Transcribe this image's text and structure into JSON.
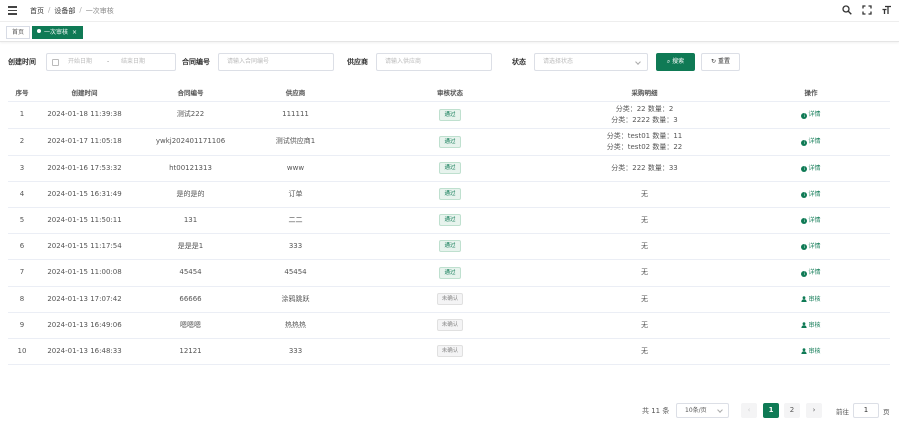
{
  "breadcrumb": [
    "首页",
    "设备部",
    "一次审核"
  ],
  "tags": {
    "home": "首页",
    "active": "一次审核",
    "close": "×"
  },
  "filters": {
    "created_label": "创建时间",
    "start_placeholder": "开始日期",
    "range_sep": "-",
    "end_placeholder": "结束日期",
    "contract_label": "合同编号",
    "contract_placeholder": "请输入合同编号",
    "supplier_label": "供应商",
    "supplier_placeholder": "请输入供应商",
    "status_label": "状态",
    "status_placeholder": "请选择状态",
    "search_button": "搜索",
    "reset_button": "重置"
  },
  "table": {
    "columns": [
      "序号",
      "创建时间",
      "合同编号",
      "供应商",
      "审核状态",
      "采购明细",
      "操作"
    ],
    "rows": [
      {
        "no": "1",
        "time": "2024-01-18 11:39:38",
        "contract": "测试222",
        "supplier": "111111",
        "status": "通过",
        "status_type": "pass",
        "details": [
          "分类：22 数量：2",
          "分类：2222 数量：3"
        ],
        "action": "详情",
        "action_icon": "info-icon"
      },
      {
        "no": "2",
        "time": "2024-01-17 11:05:18",
        "contract": "ywkj202401171106",
        "supplier": "测试供应商1",
        "status": "通过",
        "status_type": "pass",
        "details": [
          "分类：test01 数量：11",
          "分类：test02 数量：22"
        ],
        "action": "详情",
        "action_icon": "info-icon"
      },
      {
        "no": "3",
        "time": "2024-01-16 17:53:32",
        "contract": "ht00121313",
        "supplier": "www",
        "status": "通过",
        "status_type": "pass",
        "details": [
          "分类：222 数量：33"
        ],
        "action": "详情",
        "action_icon": "info-icon"
      },
      {
        "no": "4",
        "time": "2024-01-15 16:31:49",
        "contract": "是的是的",
        "supplier": "订单",
        "status": "通过",
        "status_type": "pass",
        "details": [
          "无"
        ],
        "action": "详情",
        "action_icon": "info-icon"
      },
      {
        "no": "5",
        "time": "2024-01-15 11:50:11",
        "contract": "131",
        "supplier": "二二",
        "status": "通过",
        "status_type": "pass",
        "details": [
          "无"
        ],
        "action": "详情",
        "action_icon": "info-icon"
      },
      {
        "no": "6",
        "time": "2024-01-15 11:17:54",
        "contract": "是是是1",
        "supplier": "333",
        "status": "通过",
        "status_type": "pass",
        "details": [
          "无"
        ],
        "action": "详情",
        "action_icon": "info-icon"
      },
      {
        "no": "7",
        "time": "2024-01-15 11:00:08",
        "contract": "45454",
        "supplier": "45454",
        "status": "通过",
        "status_type": "pass",
        "details": [
          "无"
        ],
        "action": "详情",
        "action_icon": "info-icon"
      },
      {
        "no": "8",
        "time": "2024-01-13 17:07:42",
        "contract": "66666",
        "supplier": "涂鸦跳跃",
        "status": "未确认",
        "status_type": "pending",
        "details": [
          "无"
        ],
        "action": "审核",
        "action_icon": "person-icon"
      },
      {
        "no": "9",
        "time": "2024-01-13 16:49:06",
        "contract": "嗯嗯嗯",
        "supplier": "热热热",
        "status": "未确认",
        "status_type": "pending",
        "details": [
          "无"
        ],
        "action": "审核",
        "action_icon": "person-icon"
      },
      {
        "no": "10",
        "time": "2024-01-13 16:48:33",
        "contract": "12121",
        "supplier": "333",
        "status": "未确认",
        "status_type": "pending",
        "details": [
          "无"
        ],
        "action": "审核",
        "action_icon": "person-icon"
      }
    ]
  },
  "pagination": {
    "total": "共 11 条",
    "page_size": "10条/页",
    "prev": "‹",
    "pages": [
      "1",
      "2"
    ],
    "current": "1",
    "next": "›",
    "goto_label": "前往",
    "goto_value": "1",
    "goto_suffix": "页"
  },
  "colors": {
    "primary": "#0f7a55"
  }
}
